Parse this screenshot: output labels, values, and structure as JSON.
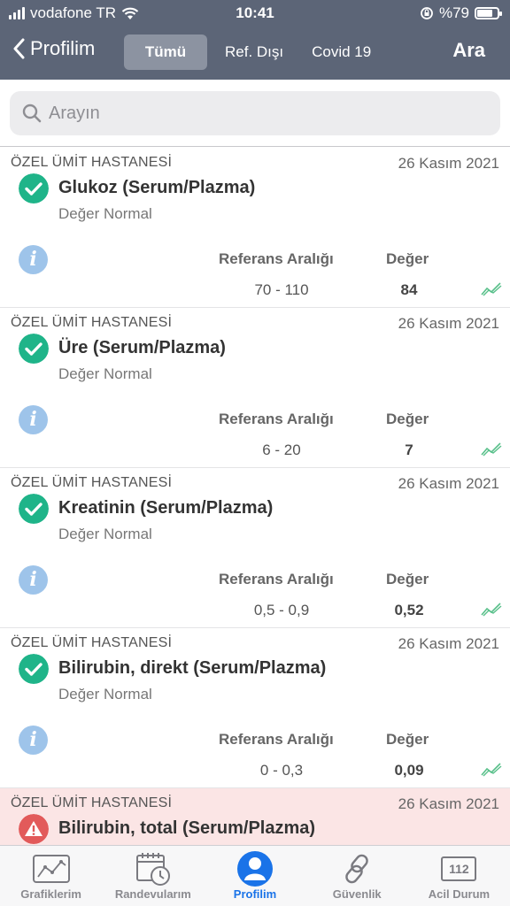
{
  "status_bar": {
    "carrier": "vodafone TR",
    "time": "10:41",
    "battery": "%79",
    "battery_level": 0.79
  },
  "nav": {
    "back_label": "Profilim",
    "tabs": [
      {
        "label": "Tümü",
        "active": true
      },
      {
        "label": "Ref. Dışı",
        "active": false
      },
      {
        "label": "Covid 19",
        "active": false
      }
    ],
    "search_label": "Ara"
  },
  "search": {
    "placeholder": "Arayın"
  },
  "columns": {
    "reference": "Referans Aralığı",
    "value": "Değer"
  },
  "results": [
    {
      "hospital": "ÖZEL ÜMİT HASTANESİ",
      "date": "26 Kasım 2021",
      "test": "Glukoz (Serum/Plazma)",
      "status": "normal",
      "status_text": "Değer Normal",
      "reference": "70 - 110",
      "value": "84"
    },
    {
      "hospital": "ÖZEL ÜMİT HASTANESİ",
      "date": "26 Kasım 2021",
      "test": "Üre (Serum/Plazma)",
      "status": "normal",
      "status_text": "Değer Normal",
      "reference": "6 - 20",
      "value": "7"
    },
    {
      "hospital": "ÖZEL ÜMİT HASTANESİ",
      "date": "26 Kasım 2021",
      "test": "Kreatinin (Serum/Plazma)",
      "status": "normal",
      "status_text": "Değer Normal",
      "reference": "0,5 - 0,9",
      "value": "0,52"
    },
    {
      "hospital": "ÖZEL ÜMİT HASTANESİ",
      "date": "26 Kasım 2021",
      "test": "Bilirubin, direkt (Serum/Plazma)",
      "status": "normal",
      "status_text": "Değer Normal",
      "reference": "0 - 0,3",
      "value": "0,09"
    },
    {
      "hospital": "ÖZEL ÜMİT HASTANESİ",
      "date": "26 Kasım 2021",
      "test": "Bilirubin, total (Serum/Plazma)",
      "status": "warning",
      "status_text": "",
      "reference": "",
      "value": ""
    }
  ],
  "tabbar": [
    {
      "label": "Grafiklerim",
      "icon": "chart-icon",
      "active": false
    },
    {
      "label": "Randevularım",
      "icon": "calendar-clock-icon",
      "active": false
    },
    {
      "label": "Profilim",
      "icon": "profile-icon",
      "active": true
    },
    {
      "label": "Güvenlik",
      "icon": "link-icon",
      "active": false
    },
    {
      "label": "Acil Durum",
      "icon": "emergency-112-icon",
      "badge": "112",
      "active": false
    }
  ],
  "colors": {
    "header": "#5c6577",
    "ok": "#1fb489",
    "warn": "#e25a5a",
    "info": "#9ec4ea",
    "active": "#1a73e8",
    "warn_row": "#fbe5e5"
  }
}
